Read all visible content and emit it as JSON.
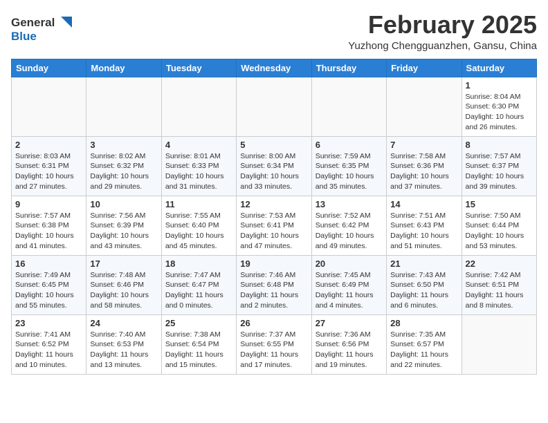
{
  "header": {
    "logo_general": "General",
    "logo_blue": "Blue",
    "month_title": "February 2025",
    "location": "Yuzhong Chengguanzhen, Gansu, China"
  },
  "weekdays": [
    "Sunday",
    "Monday",
    "Tuesday",
    "Wednesday",
    "Thursday",
    "Friday",
    "Saturday"
  ],
  "weeks": [
    [
      {
        "day": "",
        "info": ""
      },
      {
        "day": "",
        "info": ""
      },
      {
        "day": "",
        "info": ""
      },
      {
        "day": "",
        "info": ""
      },
      {
        "day": "",
        "info": ""
      },
      {
        "day": "",
        "info": ""
      },
      {
        "day": "1",
        "info": "Sunrise: 8:04 AM\nSunset: 6:30 PM\nDaylight: 10 hours\nand 26 minutes."
      }
    ],
    [
      {
        "day": "2",
        "info": "Sunrise: 8:03 AM\nSunset: 6:31 PM\nDaylight: 10 hours\nand 27 minutes."
      },
      {
        "day": "3",
        "info": "Sunrise: 8:02 AM\nSunset: 6:32 PM\nDaylight: 10 hours\nand 29 minutes."
      },
      {
        "day": "4",
        "info": "Sunrise: 8:01 AM\nSunset: 6:33 PM\nDaylight: 10 hours\nand 31 minutes."
      },
      {
        "day": "5",
        "info": "Sunrise: 8:00 AM\nSunset: 6:34 PM\nDaylight: 10 hours\nand 33 minutes."
      },
      {
        "day": "6",
        "info": "Sunrise: 7:59 AM\nSunset: 6:35 PM\nDaylight: 10 hours\nand 35 minutes."
      },
      {
        "day": "7",
        "info": "Sunrise: 7:58 AM\nSunset: 6:36 PM\nDaylight: 10 hours\nand 37 minutes."
      },
      {
        "day": "8",
        "info": "Sunrise: 7:57 AM\nSunset: 6:37 PM\nDaylight: 10 hours\nand 39 minutes."
      }
    ],
    [
      {
        "day": "9",
        "info": "Sunrise: 7:57 AM\nSunset: 6:38 PM\nDaylight: 10 hours\nand 41 minutes."
      },
      {
        "day": "10",
        "info": "Sunrise: 7:56 AM\nSunset: 6:39 PM\nDaylight: 10 hours\nand 43 minutes."
      },
      {
        "day": "11",
        "info": "Sunrise: 7:55 AM\nSunset: 6:40 PM\nDaylight: 10 hours\nand 45 minutes."
      },
      {
        "day": "12",
        "info": "Sunrise: 7:53 AM\nSunset: 6:41 PM\nDaylight: 10 hours\nand 47 minutes."
      },
      {
        "day": "13",
        "info": "Sunrise: 7:52 AM\nSunset: 6:42 PM\nDaylight: 10 hours\nand 49 minutes."
      },
      {
        "day": "14",
        "info": "Sunrise: 7:51 AM\nSunset: 6:43 PM\nDaylight: 10 hours\nand 51 minutes."
      },
      {
        "day": "15",
        "info": "Sunrise: 7:50 AM\nSunset: 6:44 PM\nDaylight: 10 hours\nand 53 minutes."
      }
    ],
    [
      {
        "day": "16",
        "info": "Sunrise: 7:49 AM\nSunset: 6:45 PM\nDaylight: 10 hours\nand 55 minutes."
      },
      {
        "day": "17",
        "info": "Sunrise: 7:48 AM\nSunset: 6:46 PM\nDaylight: 10 hours\nand 58 minutes."
      },
      {
        "day": "18",
        "info": "Sunrise: 7:47 AM\nSunset: 6:47 PM\nDaylight: 11 hours\nand 0 minutes."
      },
      {
        "day": "19",
        "info": "Sunrise: 7:46 AM\nSunset: 6:48 PM\nDaylight: 11 hours\nand 2 minutes."
      },
      {
        "day": "20",
        "info": "Sunrise: 7:45 AM\nSunset: 6:49 PM\nDaylight: 11 hours\nand 4 minutes."
      },
      {
        "day": "21",
        "info": "Sunrise: 7:43 AM\nSunset: 6:50 PM\nDaylight: 11 hours\nand 6 minutes."
      },
      {
        "day": "22",
        "info": "Sunrise: 7:42 AM\nSunset: 6:51 PM\nDaylight: 11 hours\nand 8 minutes."
      }
    ],
    [
      {
        "day": "23",
        "info": "Sunrise: 7:41 AM\nSunset: 6:52 PM\nDaylight: 11 hours\nand 10 minutes."
      },
      {
        "day": "24",
        "info": "Sunrise: 7:40 AM\nSunset: 6:53 PM\nDaylight: 11 hours\nand 13 minutes."
      },
      {
        "day": "25",
        "info": "Sunrise: 7:38 AM\nSunset: 6:54 PM\nDaylight: 11 hours\nand 15 minutes."
      },
      {
        "day": "26",
        "info": "Sunrise: 7:37 AM\nSunset: 6:55 PM\nDaylight: 11 hours\nand 17 minutes."
      },
      {
        "day": "27",
        "info": "Sunrise: 7:36 AM\nSunset: 6:56 PM\nDaylight: 11 hours\nand 19 minutes."
      },
      {
        "day": "28",
        "info": "Sunrise: 7:35 AM\nSunset: 6:57 PM\nDaylight: 11 hours\nand 22 minutes."
      },
      {
        "day": "",
        "info": ""
      }
    ]
  ]
}
